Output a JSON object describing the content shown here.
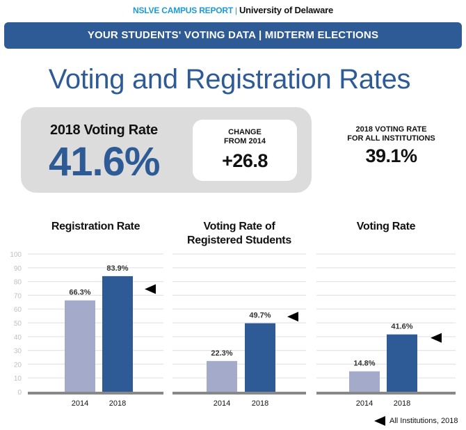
{
  "header": {
    "org": "NSLVE CAMPUS REPORT",
    "separator": "|",
    "school": "University of Delaware",
    "banner": "YOUR STUDENTS' VOTING DATA | MIDTERM ELECTIONS"
  },
  "title": "Voting and Registration Rates",
  "summary": {
    "voting_rate_label": "2018 Voting Rate",
    "voting_rate_value": "41.6%",
    "change_label_line1": "CHANGE",
    "change_label_line2": "FROM 2014",
    "change_value": "+26.8",
    "all_inst_label_line1": "2018 VOTING RATE",
    "all_inst_label_line2": "FOR ALL INSTITUTIONS",
    "all_inst_value": "39.1%"
  },
  "colors": {
    "primary": "#2e5b95",
    "bar_2014": "#a4aac9",
    "bar_2018": "#2e5b95",
    "gridline": "#e3e3e3",
    "baseline": "#888888",
    "tick": "#c0c0c0"
  },
  "legend": {
    "marker": "left-pointing-triangle",
    "label": "All Institutions, 2018"
  },
  "chart_data": [
    {
      "type": "bar",
      "title": "Registration Rate",
      "categories": [
        "2014",
        "2018"
      ],
      "values": [
        66.3,
        83.9
      ],
      "data_labels": [
        "66.3%",
        "83.9%"
      ],
      "reference_marker": {
        "label": "All Institutions, 2018",
        "value": 74.5
      },
      "ylim": [
        0,
        100
      ],
      "yticks": [
        0,
        10,
        20,
        30,
        40,
        50,
        60,
        70,
        80,
        90,
        100
      ],
      "grid": true
    },
    {
      "type": "bar",
      "title": "Voting Rate of Registered Students",
      "title_lines": [
        "Voting Rate of",
        "Registered Students"
      ],
      "categories": [
        "2014",
        "2018"
      ],
      "values": [
        22.3,
        49.7
      ],
      "data_labels": [
        "22.3%",
        "49.7%"
      ],
      "reference_marker": {
        "label": "All Institutions, 2018",
        "value": 54.5
      },
      "ylim": [
        0,
        100
      ],
      "grid": true
    },
    {
      "type": "bar",
      "title": "Voting Rate",
      "categories": [
        "2014",
        "2018"
      ],
      "values": [
        14.8,
        41.6
      ],
      "data_labels": [
        "14.8%",
        "41.6%"
      ],
      "reference_marker": {
        "label": "All Institutions, 2018",
        "value": 39.1
      },
      "ylim": [
        0,
        100
      ],
      "grid": true
    }
  ]
}
